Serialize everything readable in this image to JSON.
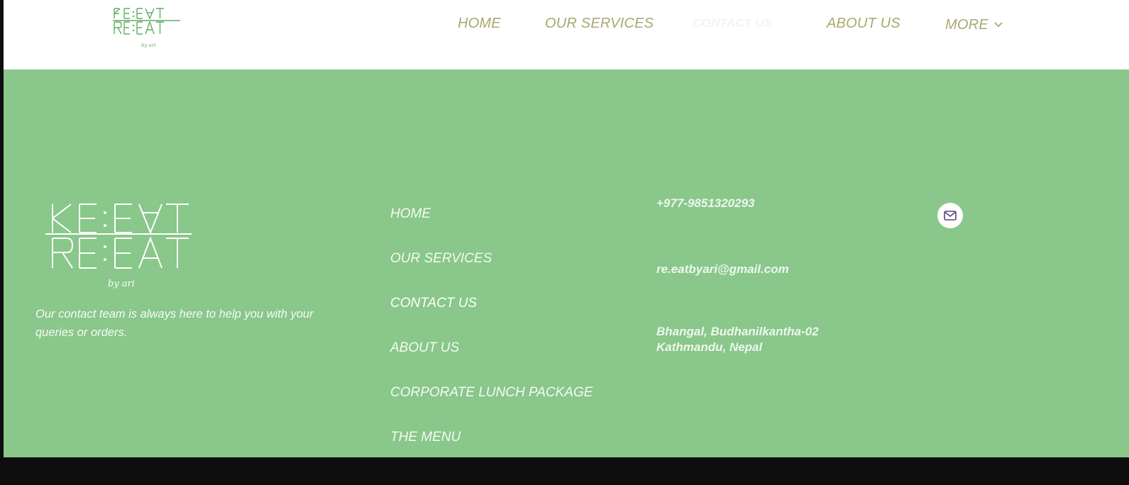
{
  "header": {
    "logo_text": "RE:EAT by ari",
    "nav": [
      {
        "label": "HOME"
      },
      {
        "label": "OUR SERVICES"
      },
      {
        "label": "CONTACT US"
      },
      {
        "label": "ABOUT US"
      },
      {
        "label": "MORE"
      }
    ],
    "more_icon": "chevron-down-icon"
  },
  "footer": {
    "logo_text": "RE:EAT by ari",
    "tagline": "Our contact team is always here to help you with your queries or orders.",
    "nav": [
      {
        "label": "HOME"
      },
      {
        "label": "OUR SERVICES"
      },
      {
        "label": "CONTACT US"
      },
      {
        "label": "ABOUT US"
      },
      {
        "label": "CORPORATE LUNCH PACKAGE"
      },
      {
        "label": "THE MENU"
      }
    ],
    "phone": "+977-9851320293",
    "email": "re.eatbyari@gmail.com",
    "address_line1": "Bhangal, Budhanilkantha-02",
    "address_line2": "Kathmandu, Nepal",
    "social_icon": "mail-icon"
  },
  "colors": {
    "header_bg": "#ffffff",
    "nav_text": "#a8a872",
    "footer_bg": "#89c78a",
    "footer_text": "#ffffff",
    "page_bg": "#0e0e0e",
    "logo_green": "#5fae63"
  }
}
